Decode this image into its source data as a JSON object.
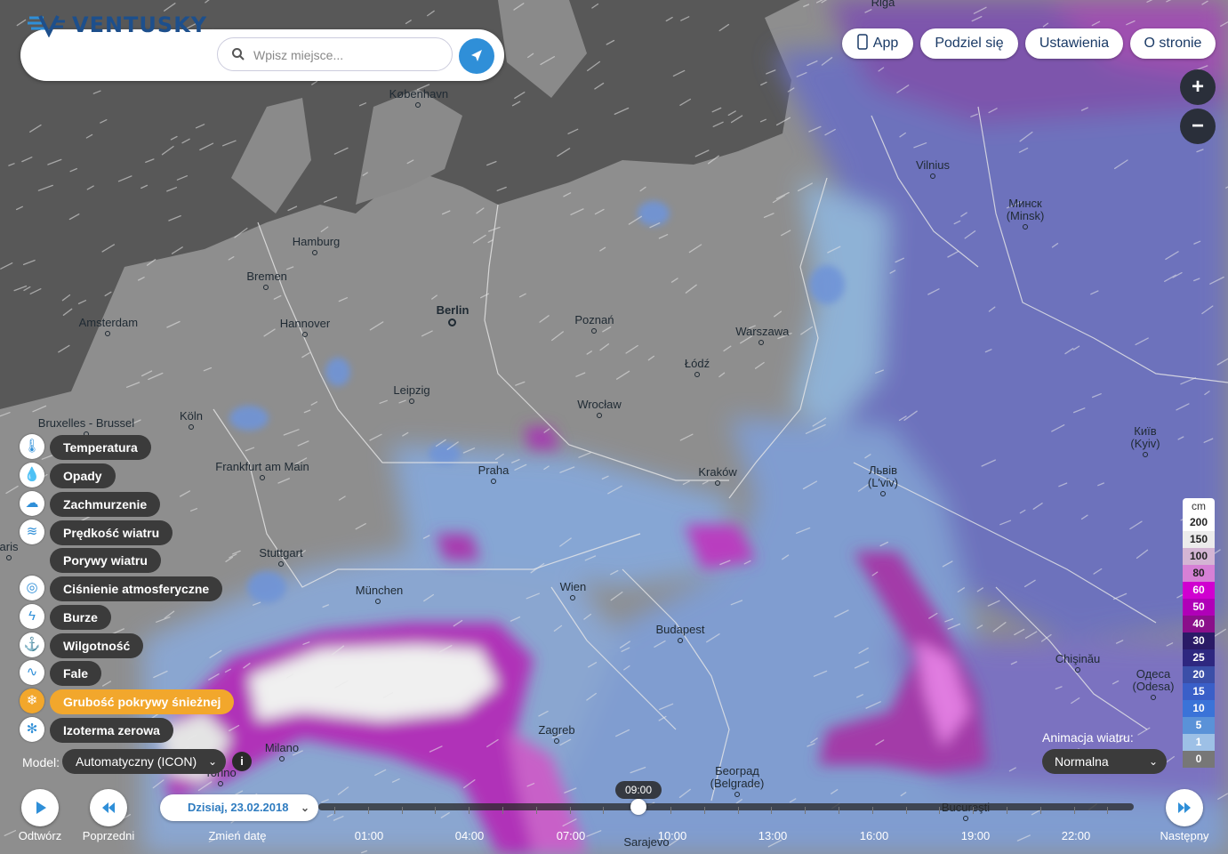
{
  "app": {
    "name": "VENTUSKY"
  },
  "search": {
    "placeholder": "Wpisz miejsce..."
  },
  "top_buttons": {
    "app": "App",
    "share": "Podziel się",
    "settings": "Ustawienia",
    "about": "O stronie"
  },
  "zoom": {
    "in": "+",
    "out": "−"
  },
  "cities": [
    {
      "name": "Riga"
    },
    {
      "name": "København"
    },
    {
      "name": "Vilnius"
    },
    {
      "name": "Минск\n(Minsk)"
    },
    {
      "name": "Hamburg"
    },
    {
      "name": "Bremen"
    },
    {
      "name": "Berlin"
    },
    {
      "name": "Amsterdam"
    },
    {
      "name": "Hannover"
    },
    {
      "name": "Poznań"
    },
    {
      "name": "Warszawa"
    },
    {
      "name": "Łódź"
    },
    {
      "name": "Leipzig"
    },
    {
      "name": "Wrocław"
    },
    {
      "name": "Bruxelles - Brussel"
    },
    {
      "name": "Köln"
    },
    {
      "name": "Київ\n(Kyiv)"
    },
    {
      "name": "Frankfurt am Main"
    },
    {
      "name": "Praha"
    },
    {
      "name": "Kraków"
    },
    {
      "name": "Львів\n(L'viv)"
    },
    {
      "name": "Stuttgart"
    },
    {
      "name": "München"
    },
    {
      "name": "Wien"
    },
    {
      "name": "Budapest"
    },
    {
      "name": "Chişinău"
    },
    {
      "name": "Одеса\n(Odesa)"
    },
    {
      "name": "Zagreb"
    },
    {
      "name": "Milano"
    },
    {
      "name": "Torino"
    },
    {
      "name": "Београд\n(Belgrade)"
    },
    {
      "name": "Bucureşti"
    },
    {
      "name": "Sarajevo"
    },
    {
      "name": "aris"
    }
  ],
  "layers": [
    {
      "label": "Temperatura",
      "icon": "thermometer-icon"
    },
    {
      "label": "Opady",
      "icon": "raindrop-icon"
    },
    {
      "label": "Zachmurzenie",
      "icon": "cloud-icon"
    },
    {
      "label": "Prędkość wiatru",
      "icon": "wind-icon"
    },
    {
      "label": "Porywy wiatru",
      "icon": ""
    },
    {
      "label": "Ciśnienie atmosferyczne",
      "icon": "pressure-icon"
    },
    {
      "label": "Burze",
      "icon": "lightning-icon"
    },
    {
      "label": "Wilgotność",
      "icon": "humidity-icon"
    },
    {
      "label": "Fale",
      "icon": "waves-icon"
    },
    {
      "label": "Grubość pokrywy śnieżnej",
      "icon": "snowflake-icon",
      "active": true
    },
    {
      "label": "Izoterma zerowa",
      "icon": "freezing-level-icon"
    }
  ],
  "model": {
    "label": "Model:",
    "value": "Automatyczny (ICON)"
  },
  "legend": {
    "unit": "cm",
    "steps": [
      {
        "label": "200",
        "color": "#ffffff"
      },
      {
        "label": "150",
        "color": "#ececec"
      },
      {
        "label": "100",
        "color": "#d4b5d4"
      },
      {
        "label": "80",
        "color": "#d680d6"
      },
      {
        "label": "60",
        "color": "#d000d0"
      },
      {
        "label": "50",
        "color": "#b000b8"
      },
      {
        "label": "40",
        "color": "#8a0f8a"
      },
      {
        "label": "30",
        "color": "#2a1a66"
      },
      {
        "label": "25",
        "color": "#2e2780"
      },
      {
        "label": "20",
        "color": "#3b4fa8"
      },
      {
        "label": "15",
        "color": "#3a5fc8"
      },
      {
        "label": "10",
        "color": "#3a73d8"
      },
      {
        "label": "5",
        "color": "#5a92d8"
      },
      {
        "label": "1",
        "color": "#9dc0e6"
      },
      {
        "label": "0",
        "color": "#777777"
      }
    ]
  },
  "wind_animation": {
    "label": "Animacja wiatru:",
    "value": "Normalna"
  },
  "timeline": {
    "play": "Odtwórz",
    "prev": "Poprzedni",
    "date": "Dzisiaj, 23.02.2018",
    "change_date": "Zmień datę",
    "next": "Następny",
    "current_time": "09:00",
    "hours": [
      "01:00",
      "04:00",
      "07:00",
      "10:00",
      "13:00",
      "16:00",
      "19:00",
      "22:00"
    ]
  },
  "colors": {
    "accent": "#2f8fd8",
    "active_layer": "#f2a72c",
    "brand": "#1d4f8c"
  }
}
